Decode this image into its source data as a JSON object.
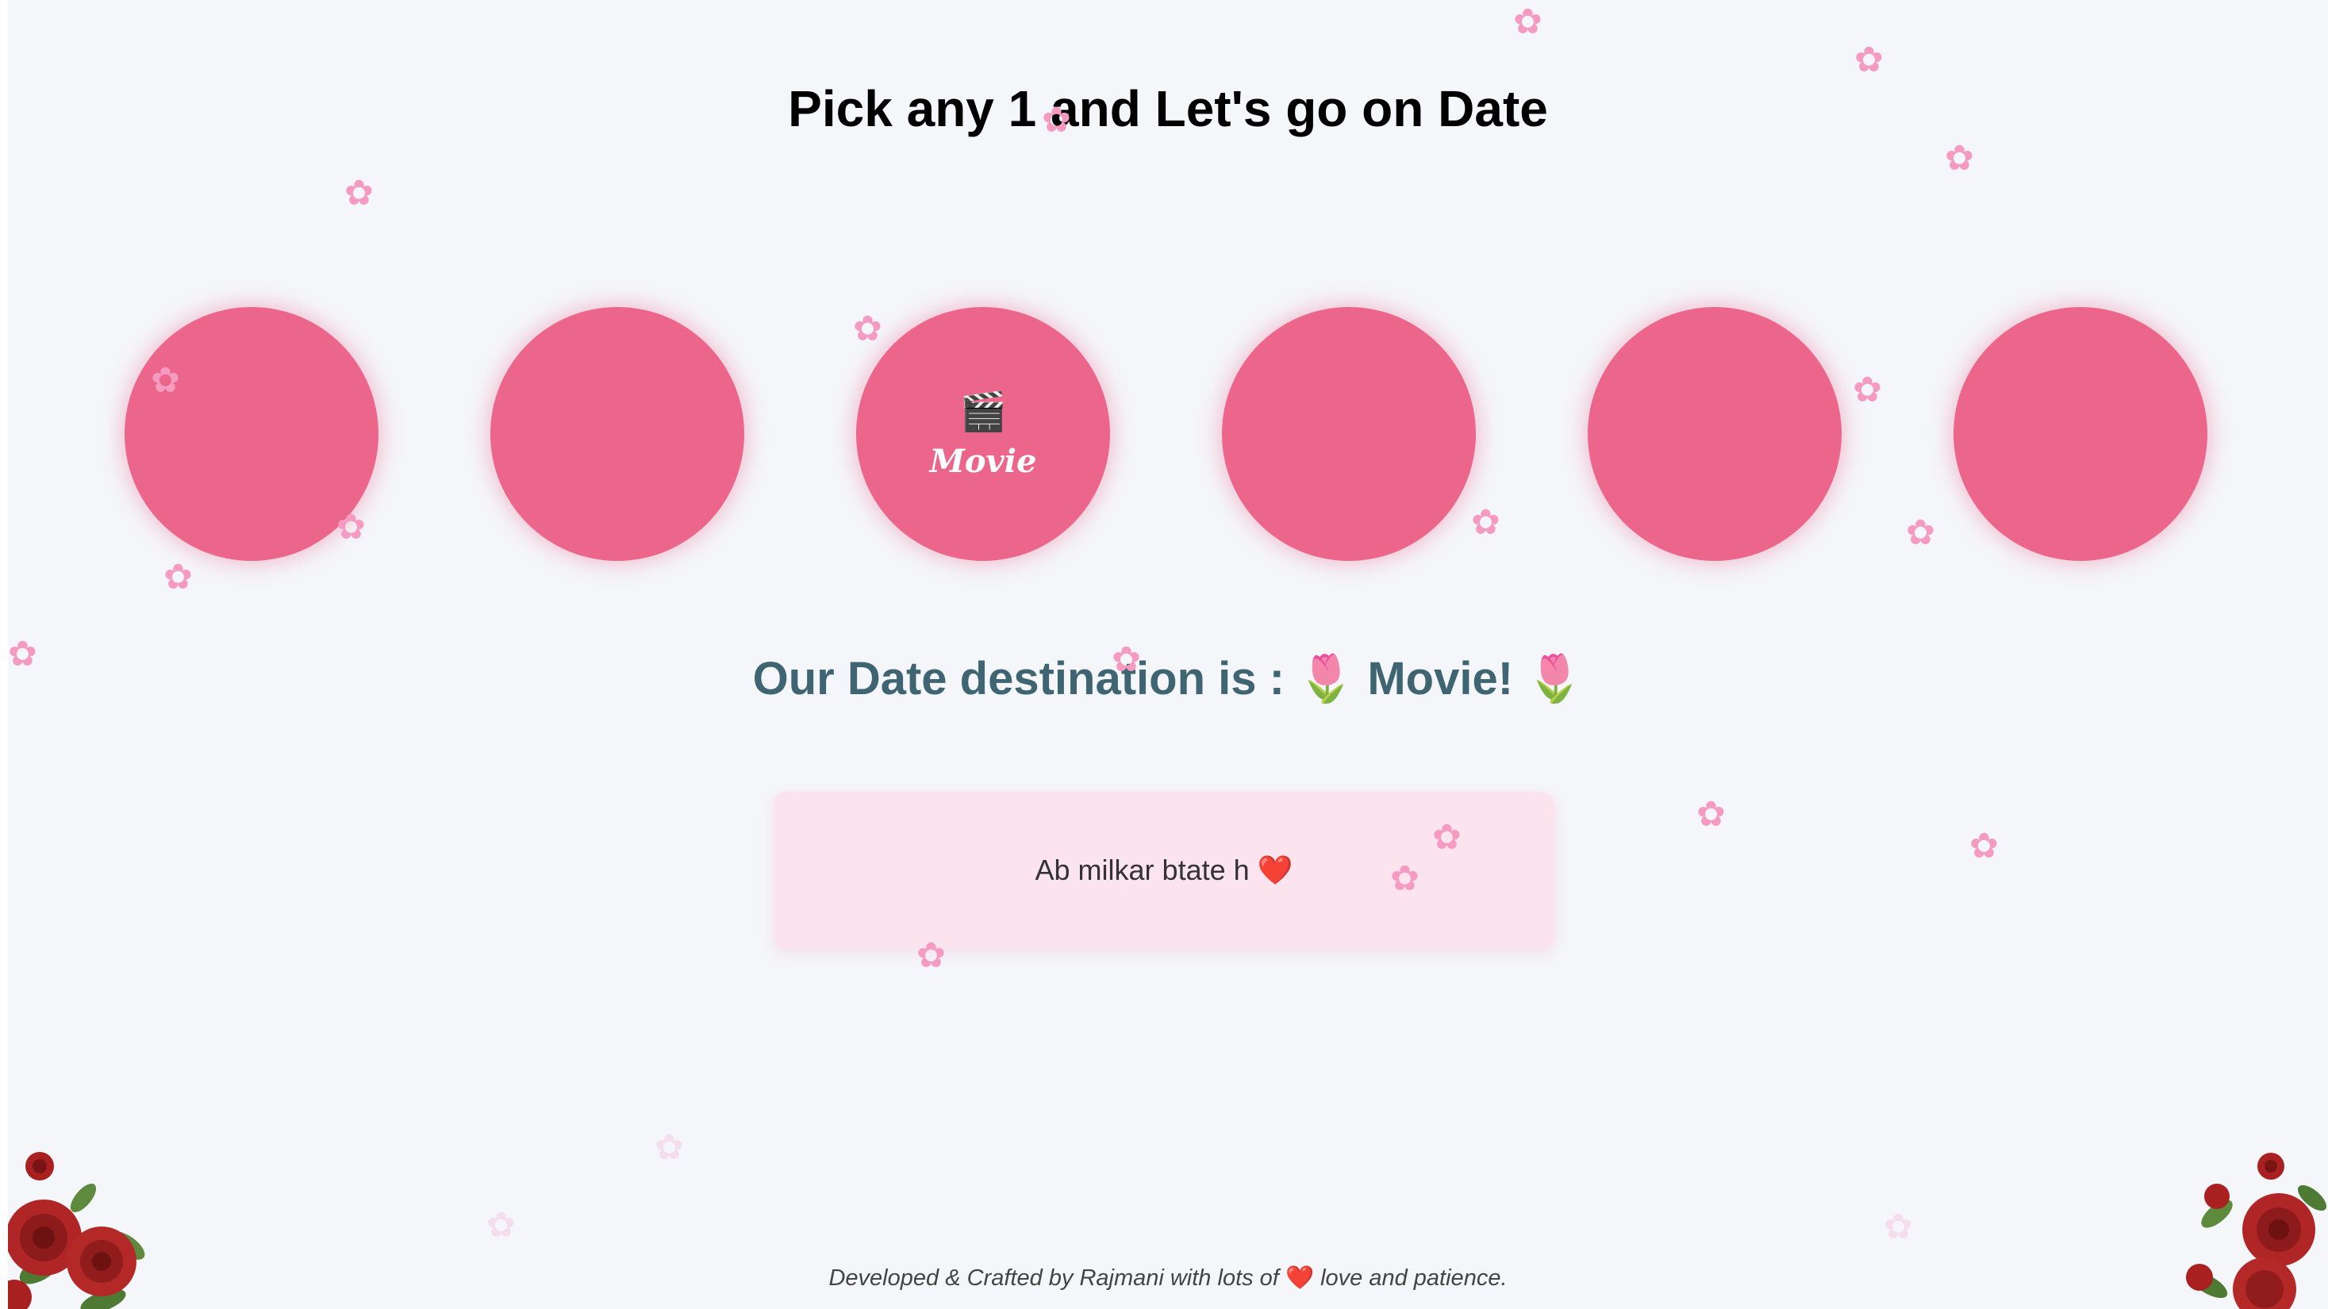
{
  "header": {
    "title": "Pick any 1 and Let's go on Date"
  },
  "options": [
    {
      "emoji": "",
      "label": ""
    },
    {
      "emoji": "",
      "label": ""
    },
    {
      "emoji": "🎬",
      "label": "Movie"
    },
    {
      "emoji": "",
      "label": ""
    },
    {
      "emoji": "",
      "label": ""
    },
    {
      "emoji": "",
      "label": ""
    }
  ],
  "result": {
    "text": "Our Date destination is : 🌷 Movie! 🌷"
  },
  "message": {
    "text": "Ab milkar btate h ❤️"
  },
  "footer": {
    "before": "Developed & Crafted by Rajmani with lots of ",
    "heart": "❤️",
    "after": " love and patience."
  },
  "colors": {
    "background": "#f5f6fa",
    "circle": "#ec668b",
    "result_text": "#3f6573",
    "message_box": "#fbe4ee"
  },
  "icons": {
    "petal": "cherry-blossom-icon",
    "corner": "rose-bouquet-icon"
  }
}
